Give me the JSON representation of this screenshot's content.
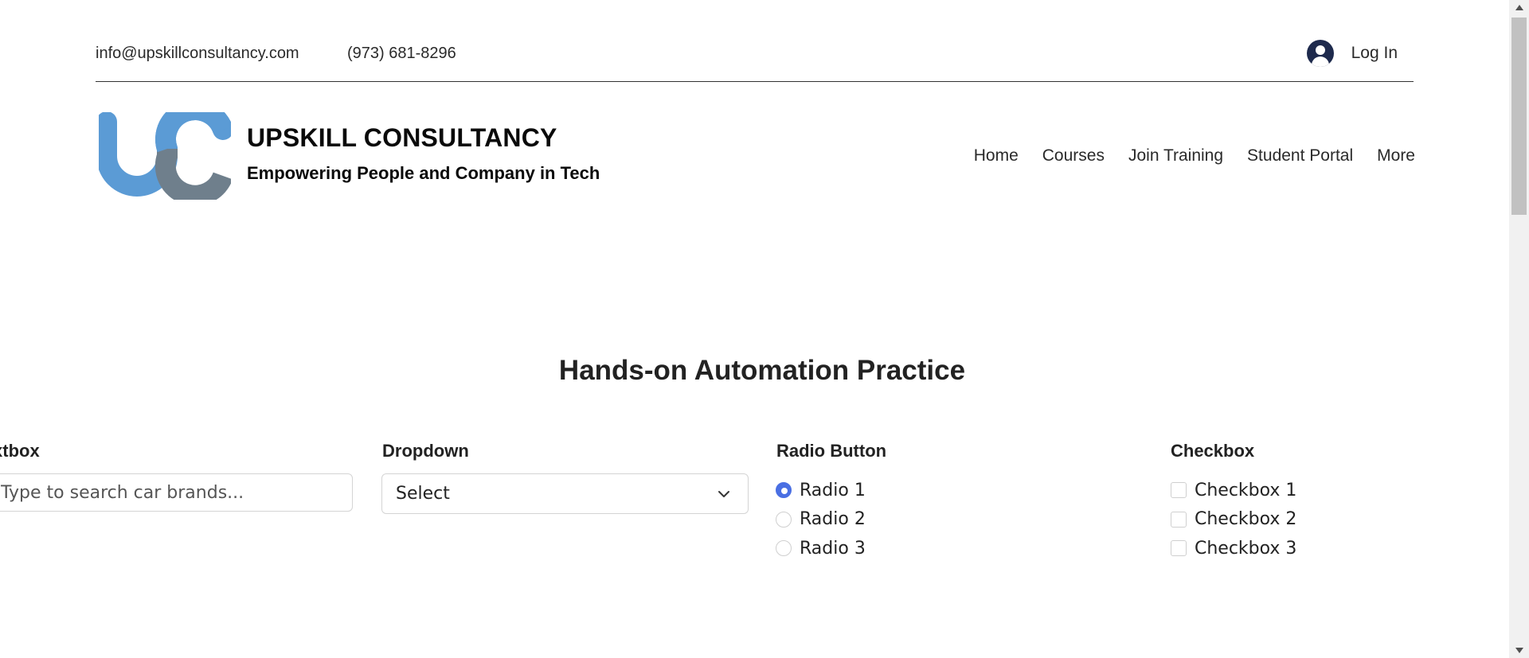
{
  "header": {
    "email": "info@upskillconsultancy.com",
    "phone": "(973) 681-8296",
    "login_label": "Log In"
  },
  "brand": {
    "title": "UPSKILL CONSULTANCY",
    "tagline": "Empowering People and Company in Tech",
    "logo_colors": {
      "primary": "#5b9bd5",
      "secondary": "#6f7f8c"
    }
  },
  "nav": {
    "items": [
      {
        "label": "Home"
      },
      {
        "label": "Courses"
      },
      {
        "label": "Join Training"
      },
      {
        "label": "Student Portal"
      },
      {
        "label": "More"
      }
    ]
  },
  "practice": {
    "title": "Hands-on Automation Practice",
    "textbox": {
      "label": "Textbox",
      "placeholder": "Type to search car brands...",
      "value": ""
    },
    "dropdown": {
      "label": "Dropdown",
      "selected": "Select"
    },
    "radio": {
      "label": "Radio Button",
      "options": [
        {
          "label": "Radio 1",
          "checked": true
        },
        {
          "label": "Radio 2",
          "checked": false
        },
        {
          "label": "Radio 3",
          "checked": false
        }
      ]
    },
    "checkbox": {
      "label": "Checkbox",
      "options": [
        {
          "label": "Checkbox 1",
          "checked": false
        },
        {
          "label": "Checkbox 2",
          "checked": false
        },
        {
          "label": "Checkbox 3",
          "checked": false
        }
      ]
    },
    "accent_color": "#4a6fe3"
  },
  "icons": {
    "user": "user-avatar-icon",
    "dropdown": "chevron-down-icon"
  }
}
